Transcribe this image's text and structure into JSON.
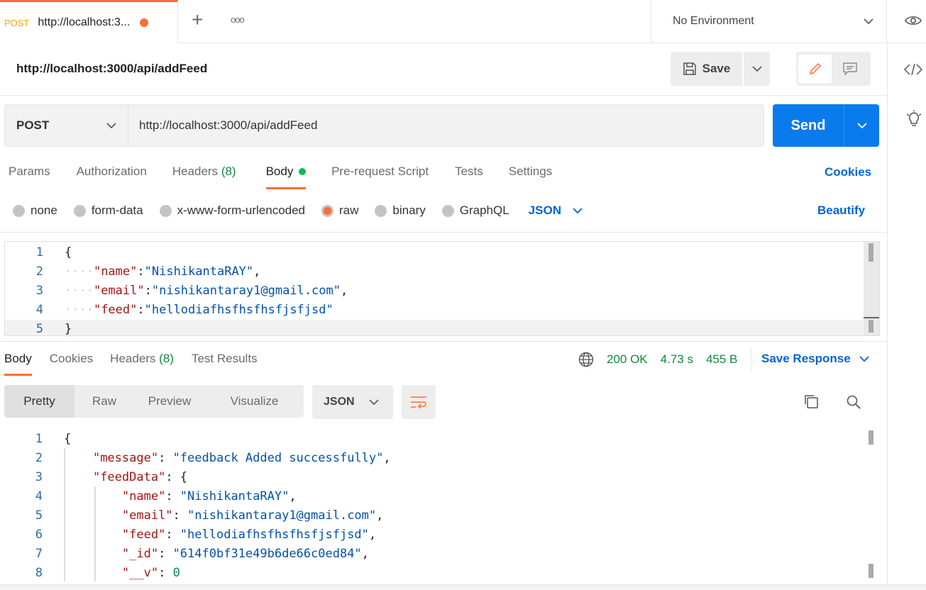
{
  "tab": {
    "method": "POST",
    "title": "http://localhost:3...",
    "plus": "+",
    "more": "ooo"
  },
  "environment": "No Environment",
  "request_title": "http://localhost:3000/api/addFeed",
  "save_label": "Save",
  "method": "POST",
  "url": "http://localhost:3000/api/addFeed",
  "send_label": "Send",
  "req_tabs": [
    {
      "label": "Params"
    },
    {
      "label": "Authorization"
    },
    {
      "label": "Headers",
      "count": "(8)"
    },
    {
      "label": "Body"
    },
    {
      "label": "Pre-request Script"
    },
    {
      "label": "Tests"
    },
    {
      "label": "Settings"
    }
  ],
  "cookies_label": "Cookies",
  "body_types": [
    "none",
    "form-data",
    "x-www-form-urlencoded",
    "raw",
    "binary",
    "GraphQL"
  ],
  "body_format": "JSON",
  "beautify_label": "Beautify",
  "request_body": [
    [
      "{"
    ],
    [
      "····",
      "\"name\"",
      ":",
      "\"NishikantaRAY\"",
      ","
    ],
    [
      "····",
      "\"email\"",
      ":",
      "\"nishikantaray1@gmail.com\"",
      ","
    ],
    [
      "····",
      "\"feed\"",
      ":",
      "\"hellodiafhsfhsfhsfjsfjsd\"",
      ""
    ],
    [
      "}"
    ]
  ],
  "res_tabs": [
    {
      "label": "Body"
    },
    {
      "label": "Cookies"
    },
    {
      "label": "Headers",
      "count": "(8)"
    },
    {
      "label": "Test Results"
    }
  ],
  "status": "200 OK",
  "time": "4.73 s",
  "size": "455 B",
  "save_response": "Save Response",
  "view_modes": [
    "Pretty",
    "Raw",
    "Preview",
    "Visualize"
  ],
  "response_format": "JSON",
  "colors": {
    "accent": "#ff6c37",
    "primary": "#097bed",
    "link": "#0265d2",
    "success": "#0f8a3c"
  },
  "response_body": [
    {
      "indent": 0,
      "text": [
        [
          "p",
          "{"
        ]
      ]
    },
    {
      "indent": 1,
      "text": [
        [
          "k",
          "\"message\""
        ],
        [
          "p",
          ": "
        ],
        [
          "s",
          "\"feedback Added successfully\""
        ],
        [
          "p",
          ","
        ]
      ]
    },
    {
      "indent": 1,
      "text": [
        [
          "k",
          "\"feedData\""
        ],
        [
          "p",
          ": {"
        ]
      ]
    },
    {
      "indent": 2,
      "text": [
        [
          "k",
          "\"name\""
        ],
        [
          "p",
          ": "
        ],
        [
          "s",
          "\"NishikantaRAY\""
        ],
        [
          "p",
          ","
        ]
      ]
    },
    {
      "indent": 2,
      "text": [
        [
          "k",
          "\"email\""
        ],
        [
          "p",
          ": "
        ],
        [
          "s",
          "\"nishikantaray1@gmail.com\""
        ],
        [
          "p",
          ","
        ]
      ]
    },
    {
      "indent": 2,
      "text": [
        [
          "k",
          "\"feed\""
        ],
        [
          "p",
          ": "
        ],
        [
          "s",
          "\"hellodiafhsfhsfhsfjsfjsd\""
        ],
        [
          "p",
          ","
        ]
      ]
    },
    {
      "indent": 2,
      "text": [
        [
          "k",
          "\"_id\""
        ],
        [
          "p",
          ": "
        ],
        [
          "s",
          "\"614f0bf31e49b6de66c0ed84\""
        ],
        [
          "p",
          ","
        ]
      ]
    },
    {
      "indent": 2,
      "text": [
        [
          "k",
          "\"__v\""
        ],
        [
          "p",
          ": "
        ],
        [
          "n",
          "0"
        ]
      ]
    }
  ]
}
